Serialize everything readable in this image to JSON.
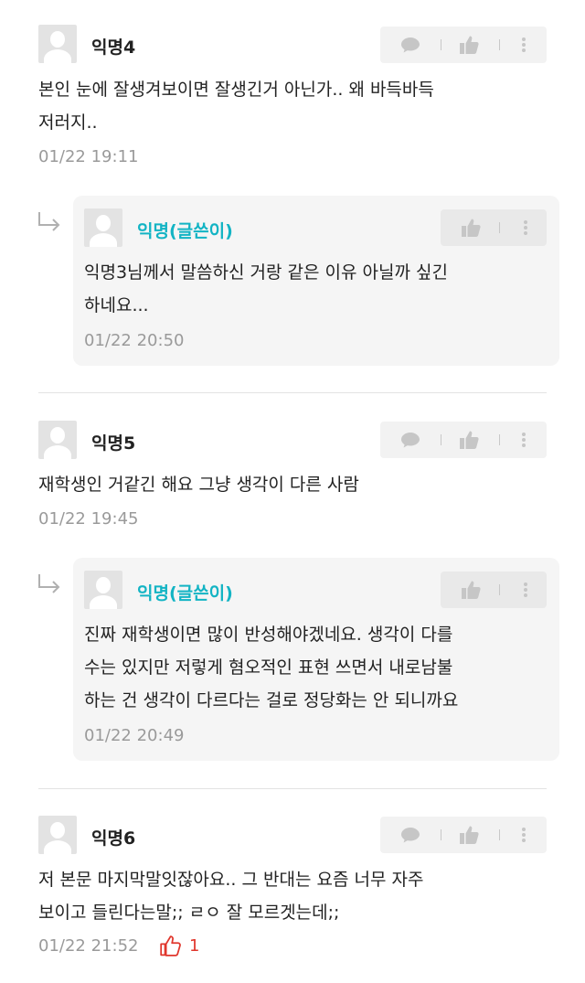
{
  "comments": [
    {
      "author": "익명4",
      "lines": [
        "본인 눈에 잘생겨보이면 잘생긴거 아닌가.. 왜 바득바득",
        "저러지.."
      ],
      "time": "01/22 19:11",
      "reply": {
        "author": "익명(글쓴이)",
        "lines": [
          "익명3님께서 말씀하신 거랑 같은 이유 아닐까 싶긴",
          "하네요..."
        ],
        "time": "01/22 20:50"
      }
    },
    {
      "author": "익명5",
      "lines": [
        "재학생인 거같긴 해요 그냥 생각이 다른 사람"
      ],
      "time": "01/22 19:45",
      "reply": {
        "author": "익명(글쓴이)",
        "lines": [
          "진짜 재학생이면 많이 반성해야겠네요. 생각이 다를",
          "수는 있지만 저렇게 혐오적인 표현 쓰면서 내로남불",
          "하는 건 생각이 다르다는 걸로 정당화는 안 되니까요"
        ],
        "time": "01/22 20:49"
      }
    },
    {
      "author": "익명6",
      "lines": [
        "저 본문 마지막말잇잖아요.. 그 반대는 요즘 너무 자주",
        "보이고 들린다는말;; ㄹㅇ 잘 모르겟는데;;"
      ],
      "time": "01/22 21:52",
      "like_count": "1"
    }
  ],
  "icons": {
    "comment": "speech-bubble-icon",
    "like": "thumbs-up-icon",
    "more": "more-vertical-icon",
    "reply": "reply-arrow-icon",
    "like_outline": "thumbs-up-outline-icon"
  },
  "colors": {
    "op_author": "#13b4c4",
    "like": "#e0362c"
  }
}
